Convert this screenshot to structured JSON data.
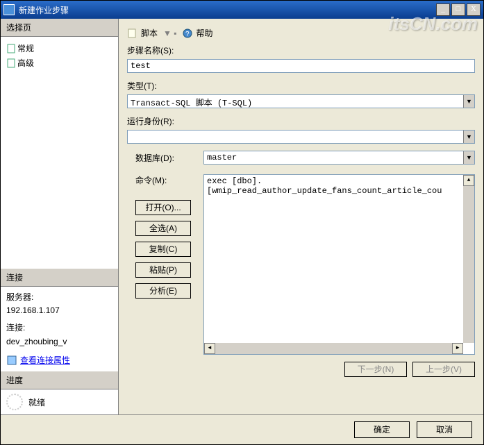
{
  "window": {
    "title": "新建作业步骤",
    "min": "_",
    "max": "□",
    "close": "X"
  },
  "left": {
    "select_page": "选择页",
    "tree": {
      "general": "常规",
      "advanced": "高级"
    },
    "connection": {
      "header": "连接",
      "server_label": "服务器:",
      "server_value": "192.168.1.107",
      "conn_label": "连接:",
      "conn_value": "dev_zhoubing_v",
      "view_link": "查看连接属性"
    },
    "progress": {
      "header": "进度",
      "status": "就绪"
    }
  },
  "toolbar": {
    "script": "脚本",
    "help": "帮助",
    "sep": "▼ ▪"
  },
  "form": {
    "step_name_label": "步骤名称(S):",
    "step_name_value": "test",
    "type_label": "类型(T):",
    "type_value": "Transact-SQL 脚本 (T-SQL)",
    "runas_label": "运行身份(R):",
    "runas_value": "",
    "database_label": "数据库(D):",
    "database_value": "master",
    "command_label": "命令(M):",
    "command_value": "exec [dbo].[wmip_read_author_update_fans_count_article_cou",
    "buttons": {
      "open": "打开(O)...",
      "select_all": "全选(A)",
      "copy": "复制(C)",
      "paste": "粘贴(P)",
      "parse": "分析(E)"
    },
    "nav": {
      "next": "下一步(N)",
      "prev": "上一步(V)"
    }
  },
  "footer": {
    "ok": "确定",
    "cancel": "取消"
  },
  "watermark": "itsCN.com"
}
